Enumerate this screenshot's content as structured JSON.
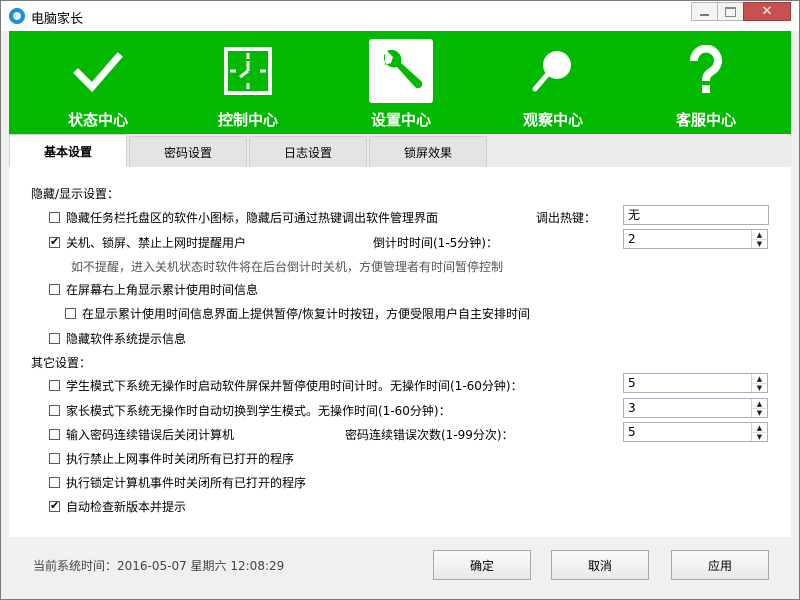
{
  "window": {
    "title": "电脑家长",
    "close_glyph": "✕"
  },
  "nav": [
    {
      "label": "状态中心",
      "icon": "checkmark-icon"
    },
    {
      "label": "控制中心",
      "icon": "clock-icon"
    },
    {
      "label": "设置中心",
      "icon": "wrench-icon",
      "active": true
    },
    {
      "label": "观察中心",
      "icon": "magnifier-icon"
    },
    {
      "label": "客服中心",
      "icon": "question-icon"
    }
  ],
  "tabs": [
    {
      "label": "基本设置",
      "active": true
    },
    {
      "label": "密码设置"
    },
    {
      "label": "日志设置"
    },
    {
      "label": "锁屏效果"
    }
  ],
  "hide_section": {
    "title": "隐藏/显示设置：",
    "hide_tray_icon": {
      "label": "隐藏任务栏托盘区的软件小图标，隐藏后可通过热键调出软件管理界面",
      "checked": false
    },
    "hotkey": {
      "label": "调出热键：",
      "value": "无"
    },
    "shutdown_remind": {
      "label": "关机、锁屏、禁止上网时提醒用户",
      "checked": true
    },
    "countdown": {
      "label": "倒计时时间(1-5分钟)：",
      "value": "2"
    },
    "hint": "如不提醒，进入关机状态时软件将在后台倒计时关机，方便管理者有时间暂停控制",
    "show_usage_time": {
      "label": "在屏幕右上角显示累计使用时间信息",
      "checked": false
    },
    "show_pause_button": {
      "label": "在显示累计使用时间信息界面上提供暂停/恢复计时按钮，方便受限用户自主安排时间",
      "checked": false
    },
    "hide_system_tips": {
      "label": "隐藏软件系统提示信息",
      "checked": false
    }
  },
  "other_section": {
    "title": "其它设置：",
    "student_idle": {
      "label": "学生模式下系统无操作时启动软件屏保并暂停使用时间计时。无操作时间(1-60分钟)：",
      "checked": false,
      "value": "5"
    },
    "parent_idle": {
      "label": "家长模式下系统无操作时自动切换到学生模式。无操作时间(1-60分钟)：",
      "checked": false,
      "value": "3"
    },
    "wrong_password": {
      "label": "输入密码连续错误后关闭计算机",
      "checked": false,
      "count_label": "密码连续错误次数(1-99分次)：",
      "value": "5"
    },
    "close_on_block": {
      "label": "执行禁止上网事件时关闭所有已打开的程序",
      "checked": false
    },
    "close_on_lock": {
      "label": "执行锁定计算机事件时关闭所有已打开的程序",
      "checked": false
    },
    "auto_update": {
      "label": "自动检查新版本并提示",
      "checked": true
    }
  },
  "footer": {
    "time_text": "当前系统时间：2016-05-07  星期六  12:08:29",
    "ok_label": "确定",
    "cancel_label": "取消",
    "apply_label": "应用"
  },
  "colors": {
    "green": "#00b900",
    "close_red": "#c75050"
  }
}
